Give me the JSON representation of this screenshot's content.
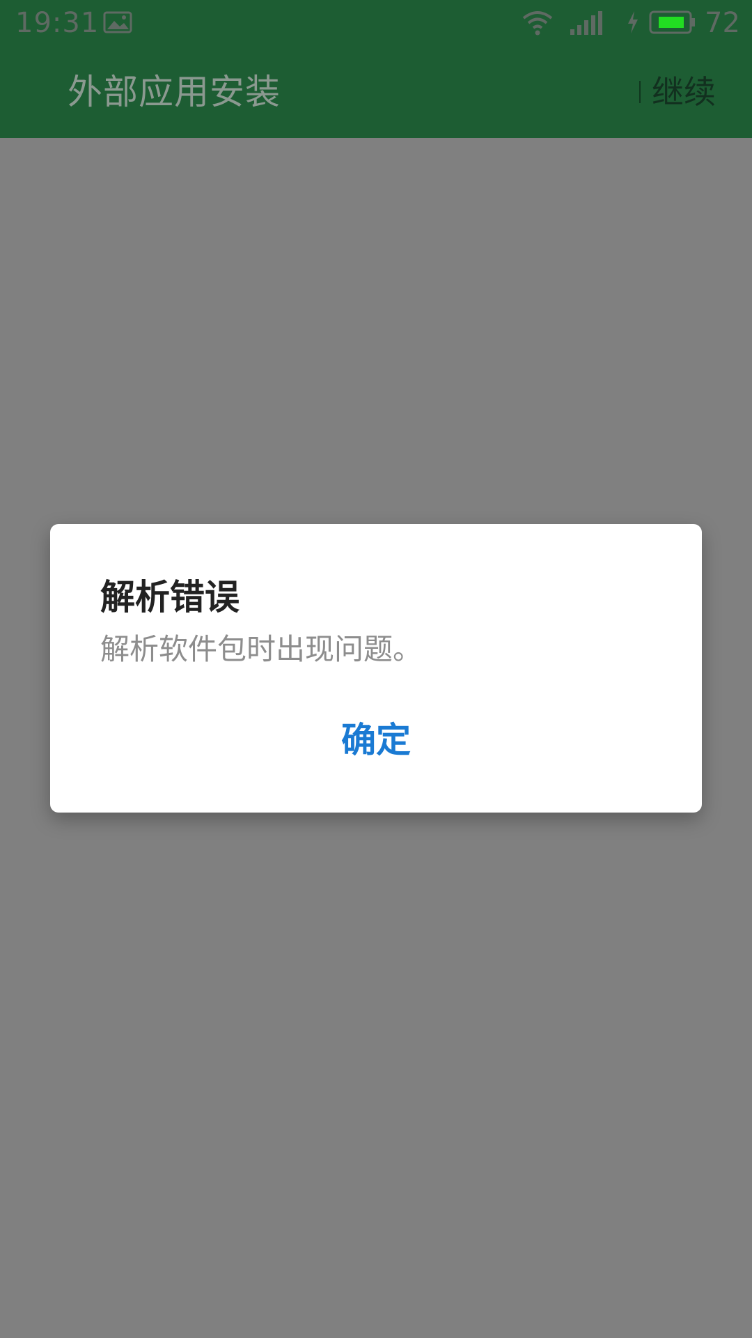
{
  "status_bar": {
    "time": "19:31",
    "battery_level": "72",
    "icons": [
      "gallery-icon",
      "wifi-icon",
      "signal-icon",
      "charging-icon",
      "battery-icon"
    ],
    "battery_fill_color": "#22dd22"
  },
  "app_bar": {
    "title": "外部应用安装",
    "continue_label": "继续",
    "background_color": "#1d5d33"
  },
  "dialog": {
    "title": "解析错误",
    "message": "解析软件包时出现问题。",
    "ok_label": "确定",
    "ok_color": "#1a7ad3"
  }
}
